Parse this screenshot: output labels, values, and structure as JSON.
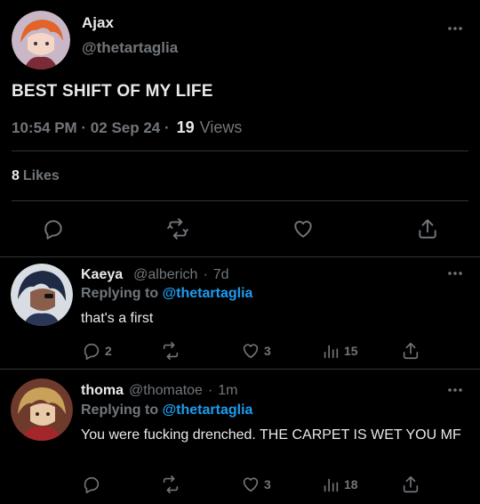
{
  "main_tweet": {
    "author_name": "Ajax",
    "author_handle": "@thetartaglia",
    "text": "BEST SHIFT OF MY LIFE",
    "time": "10:54 PM · 02 Sep 24 ·",
    "views_count": "19",
    "views_label": "Views",
    "likes_count": "8",
    "likes_label": "Likes"
  },
  "replies": [
    {
      "name": "Kaeya",
      "handle": "@alberich",
      "dot": "·",
      "time": "7d",
      "replying_prefix": "Replying to",
      "replying_to": "@thetartaglia",
      "text": "that's a first",
      "reply_count": "2",
      "retweet_count": "",
      "like_count": "3",
      "view_count": "15"
    },
    {
      "name": "thoma",
      "handle": "@thomatoe",
      "dot": "·",
      "time": "1m",
      "replying_prefix": "Replying to",
      "replying_to": "@thetartaglia",
      "text": "You were fucking drenched. THE CARPET IS WET YOU MF",
      "reply_count": "",
      "retweet_count": "",
      "like_count": "3",
      "view_count": "18"
    }
  ],
  "colors": {
    "background": "#000000",
    "text": "#e7e9ea",
    "muted": "#71767b",
    "link": "#1d9bf0",
    "divider": "#2f3336"
  },
  "icons": [
    "more-icon",
    "reply-icon",
    "retweet-icon",
    "like-icon",
    "share-icon",
    "views-icon"
  ]
}
